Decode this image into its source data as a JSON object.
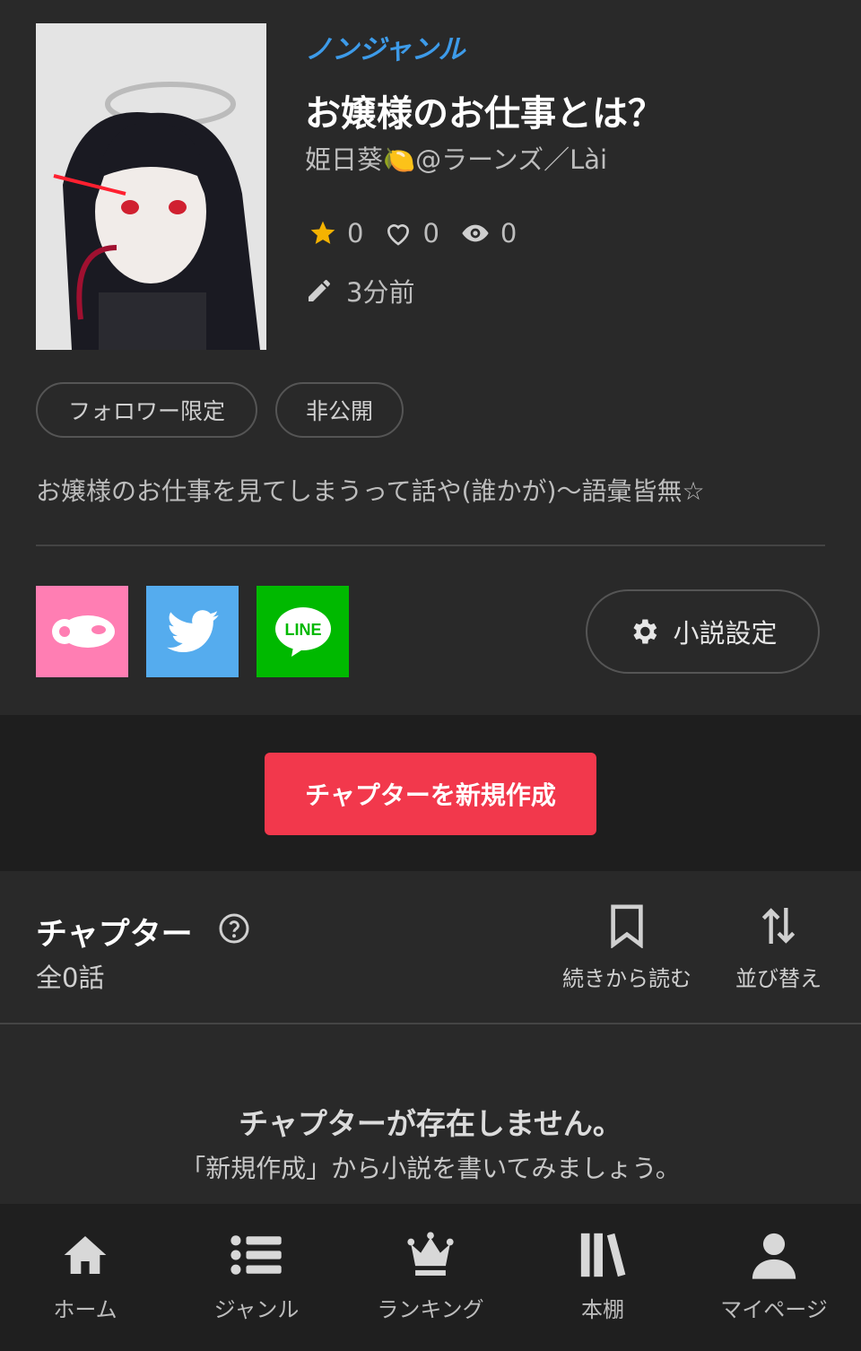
{
  "novel": {
    "genre": "ノンジャンル",
    "title": "お嬢様のお仕事とは？",
    "author": "姫日葵🍋@ラーンズ／Lài",
    "stars": "0",
    "likes": "0",
    "views": "0",
    "updated": "3分前",
    "tags": [
      "フォロワー限定",
      "非公開"
    ],
    "description": "お嬢様のお仕事を見てしまうって話や(誰かが)〜語彙皆無☆",
    "settings_label": "小説設定"
  },
  "share": {
    "line_text": "LINE"
  },
  "create_label": "チャプターを新規作成",
  "chapters": {
    "title": "チャプター",
    "count": "全0話",
    "continue_label": "続きから読む",
    "sort_label": "並び替え",
    "empty_title": "チャプターが存在しません。",
    "empty_sub": "「新規作成」から小説を書いてみましょう。"
  },
  "nav": {
    "items": [
      {
        "label": "ホーム",
        "icon": "home-icon"
      },
      {
        "label": "ジャンル",
        "icon": "list-icon"
      },
      {
        "label": "ランキング",
        "icon": "crown-icon"
      },
      {
        "label": "本棚",
        "icon": "bookshelf-icon"
      },
      {
        "label": "マイページ",
        "icon": "person-icon"
      }
    ]
  },
  "colors": {
    "accent_red": "#f2384c",
    "genre_blue": "#3d9be9",
    "share_pink": "#ff7eb3",
    "share_twitter": "#55acee",
    "share_line": "#00b900",
    "star": "#f5b301"
  }
}
